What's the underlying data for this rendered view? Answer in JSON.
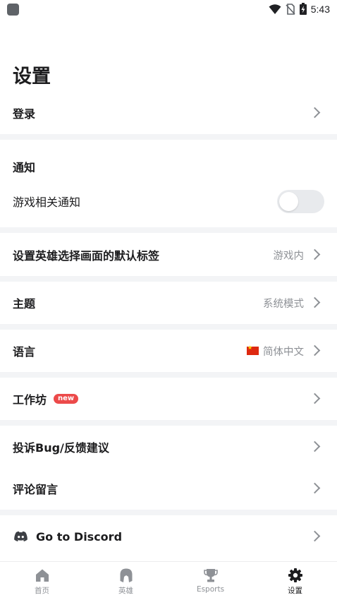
{
  "status_bar": {
    "time": "5:43"
  },
  "page": {
    "title": "设置"
  },
  "rows": {
    "login": {
      "label": "登录"
    },
    "notifications_header": {
      "label": "通知"
    },
    "game_notifications": {
      "label": "游戏相关通知",
      "enabled": false
    },
    "hero_tab": {
      "label": "设置英雄选择画面的默认标签",
      "value": "游戏内"
    },
    "theme": {
      "label": "主题",
      "value": "系统模式"
    },
    "language": {
      "label": "语言",
      "value": "简体中文"
    },
    "workshop": {
      "label": "工作坊",
      "badge": "new"
    },
    "feedback": {
      "label": "投诉Bug/反馈建议"
    },
    "review": {
      "label": "评论留言"
    },
    "discord": {
      "label": "Go to Discord"
    }
  },
  "tabs": [
    {
      "label": "首页",
      "icon": "home-icon",
      "active": false
    },
    {
      "label": "英雄",
      "icon": "champion-icon",
      "active": false
    },
    {
      "label": "Esports",
      "icon": "trophy-icon",
      "active": false
    },
    {
      "label": "设置",
      "icon": "gear-icon",
      "active": true
    }
  ],
  "colors": {
    "badge": "#ec4a4a",
    "separator": "#f3f4f6",
    "secondary_text": "#8e9196"
  }
}
